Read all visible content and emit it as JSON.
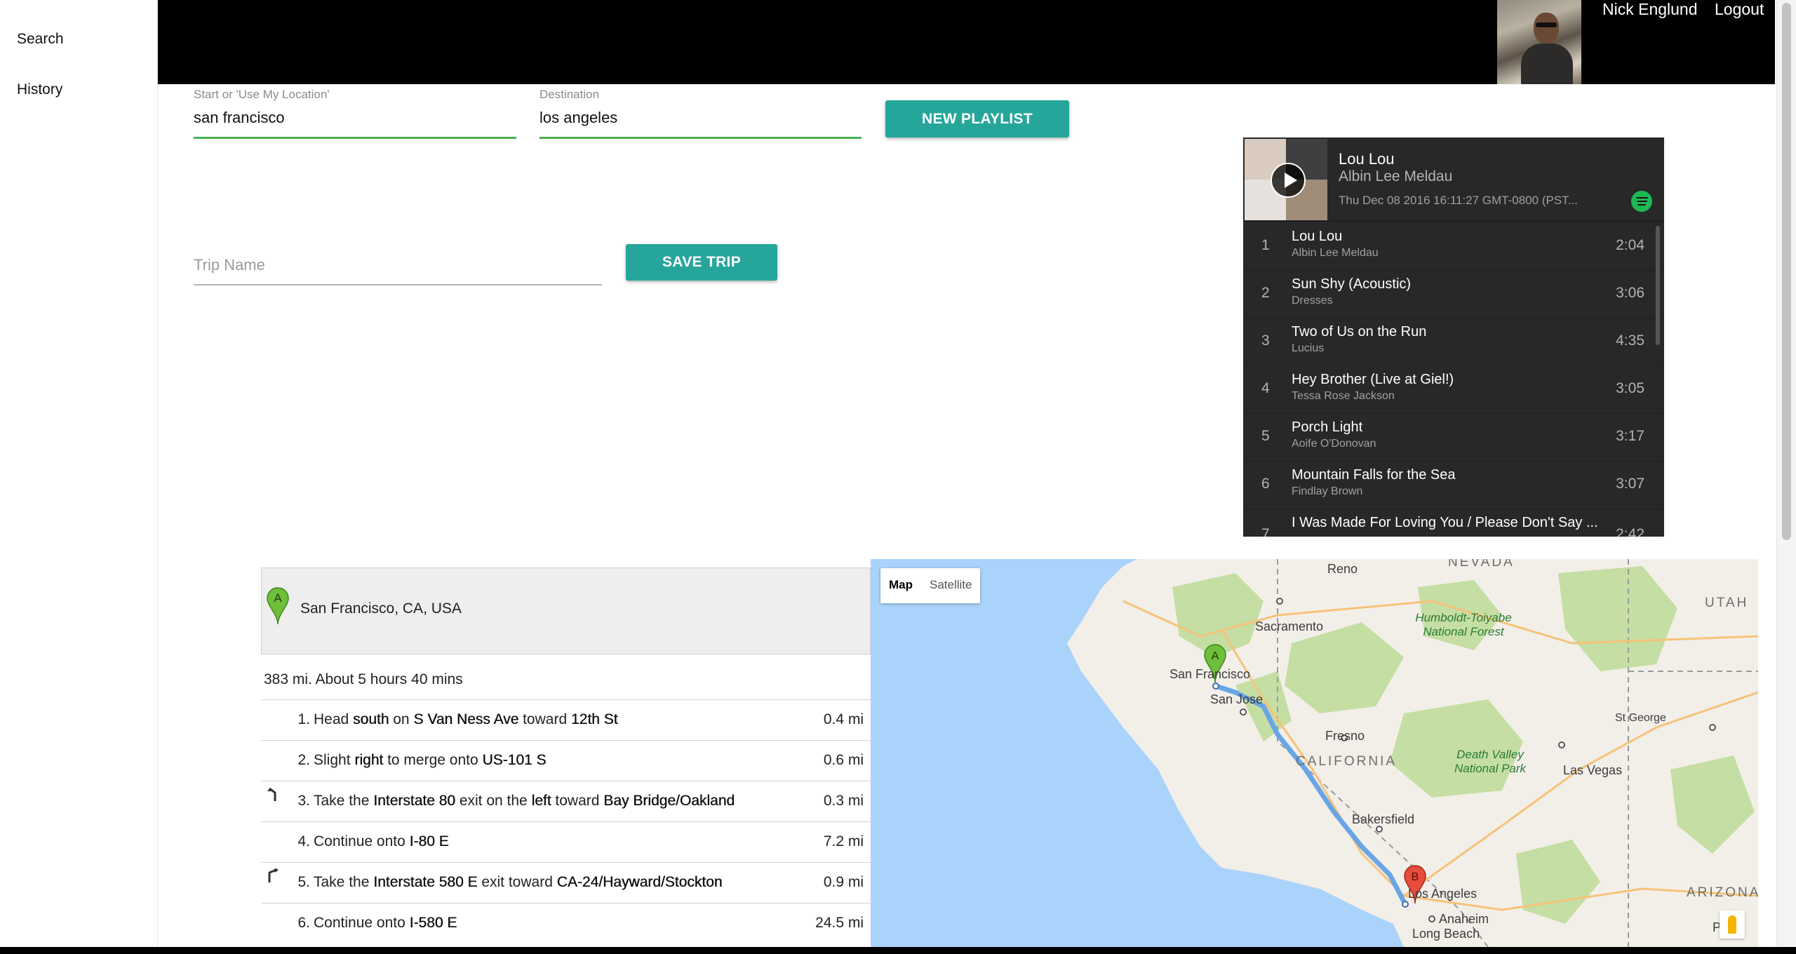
{
  "sidebar": {
    "items": [
      {
        "label": "Search"
      },
      {
        "label": "History"
      }
    ]
  },
  "topbar": {
    "user_name": "Nick Englund",
    "logout_label": "Logout"
  },
  "form": {
    "start": {
      "label": "Start or 'Use My Location'",
      "value": "san francisco"
    },
    "destination": {
      "label": "Destination",
      "value": "los angeles"
    },
    "new_playlist_label": "NEW PLAYLIST",
    "trip_name": {
      "placeholder": "Trip Name",
      "value": ""
    },
    "save_trip_label": "SAVE TRIP"
  },
  "player": {
    "now_playing": {
      "title": "Lou Lou",
      "artist": "Albin Lee Meldau",
      "date": "Thu Dec 08 2016 16:11:27 GMT-0800 (PST..."
    },
    "tracks": [
      {
        "num": "1",
        "title": "Lou Lou",
        "artist": "Albin Lee Meldau",
        "duration": "2:04"
      },
      {
        "num": "2",
        "title": "Sun Shy (Acoustic)",
        "artist": "Dresses",
        "duration": "3:06"
      },
      {
        "num": "3",
        "title": "Two of Us on the Run",
        "artist": "Lucius",
        "duration": "4:35"
      },
      {
        "num": "4",
        "title": "Hey Brother (Live at Giel!)",
        "artist": "Tessa Rose Jackson",
        "duration": "3:05"
      },
      {
        "num": "5",
        "title": "Porch Light",
        "artist": "Aoife O'Donovan",
        "duration": "3:17"
      },
      {
        "num": "6",
        "title": "Mountain Falls for the Sea",
        "artist": "Findlay Brown",
        "duration": "3:07"
      },
      {
        "num": "7",
        "title": "I Was Made For Loving You / Please Don't Say ...",
        "artist": "",
        "duration": "2:42"
      }
    ],
    "colors": {
      "background": "#282828",
      "spotify": "#1db954"
    }
  },
  "directions": {
    "start_marker": "A",
    "start_address": "San Francisco, CA, USA",
    "summary": "383 mi. About 5 hours 40 mins",
    "steps": [
      {
        "num": "1.",
        "parts": [
          "Head ",
          "south",
          " on ",
          "S Van Ness Ave",
          " toward ",
          "12th St"
        ],
        "distance": "0.4 mi",
        "maneuver": ""
      },
      {
        "num": "2.",
        "parts": [
          "Slight ",
          "right",
          " to merge onto ",
          "US-101 S"
        ],
        "distance": "0.6 mi",
        "maneuver": ""
      },
      {
        "num": "3.",
        "parts": [
          "Take the ",
          "Interstate 80",
          " exit on the ",
          "left",
          " toward ",
          "Bay Bridge/Oakland"
        ],
        "distance": "0.3 mi",
        "maneuver": "ramp-left-icon"
      },
      {
        "num": "4.",
        "parts": [
          "Continue onto ",
          "I-80 E"
        ],
        "distance": "7.2 mi",
        "maneuver": ""
      },
      {
        "num": "5.",
        "parts": [
          "Take the ",
          "Interstate 580 E",
          " exit toward ",
          "CA-24/Hayward/Stockton"
        ],
        "distance": "0.9 mi",
        "maneuver": "fork-right-icon"
      },
      {
        "num": "6.",
        "parts": [
          "Continue onto ",
          "I-580 E"
        ],
        "distance": "24.5 mi",
        "maneuver": ""
      }
    ]
  },
  "map": {
    "type_buttons": [
      "Map",
      "Satellite"
    ],
    "selected_type": "Map",
    "markers": {
      "start": "A",
      "end": "B"
    },
    "labels": {
      "nevada": "NEVADA",
      "utah": "UTAH",
      "california": "CALIFORNIA",
      "arizona": "ARIZONA",
      "reno": "Reno",
      "sacramento": "Sacramento",
      "san_francisco": "San Francisco",
      "san_jose": "San Jose",
      "fresno": "Fresno",
      "bakersfield": "Bakersfield",
      "los_angeles": "Los Angeles",
      "anaheim": "Anaheim",
      "long_beach": "Long Beach",
      "las_vegas": "Las Vegas",
      "st_george": "St George",
      "phoe": "Phoe",
      "humboldt_1": "Humboldt-Toiyabe",
      "humboldt_2": "National Forest",
      "death_valley_1": "Death Valley",
      "death_valley_2": "National Park"
    },
    "colors": {
      "water": "#aad3fb",
      "land": "#f2efe9",
      "park": "#c5dea3",
      "route": "#6aa6e6",
      "marker_a": "#6fbe3c",
      "marker_b": "#e74c3c"
    }
  }
}
